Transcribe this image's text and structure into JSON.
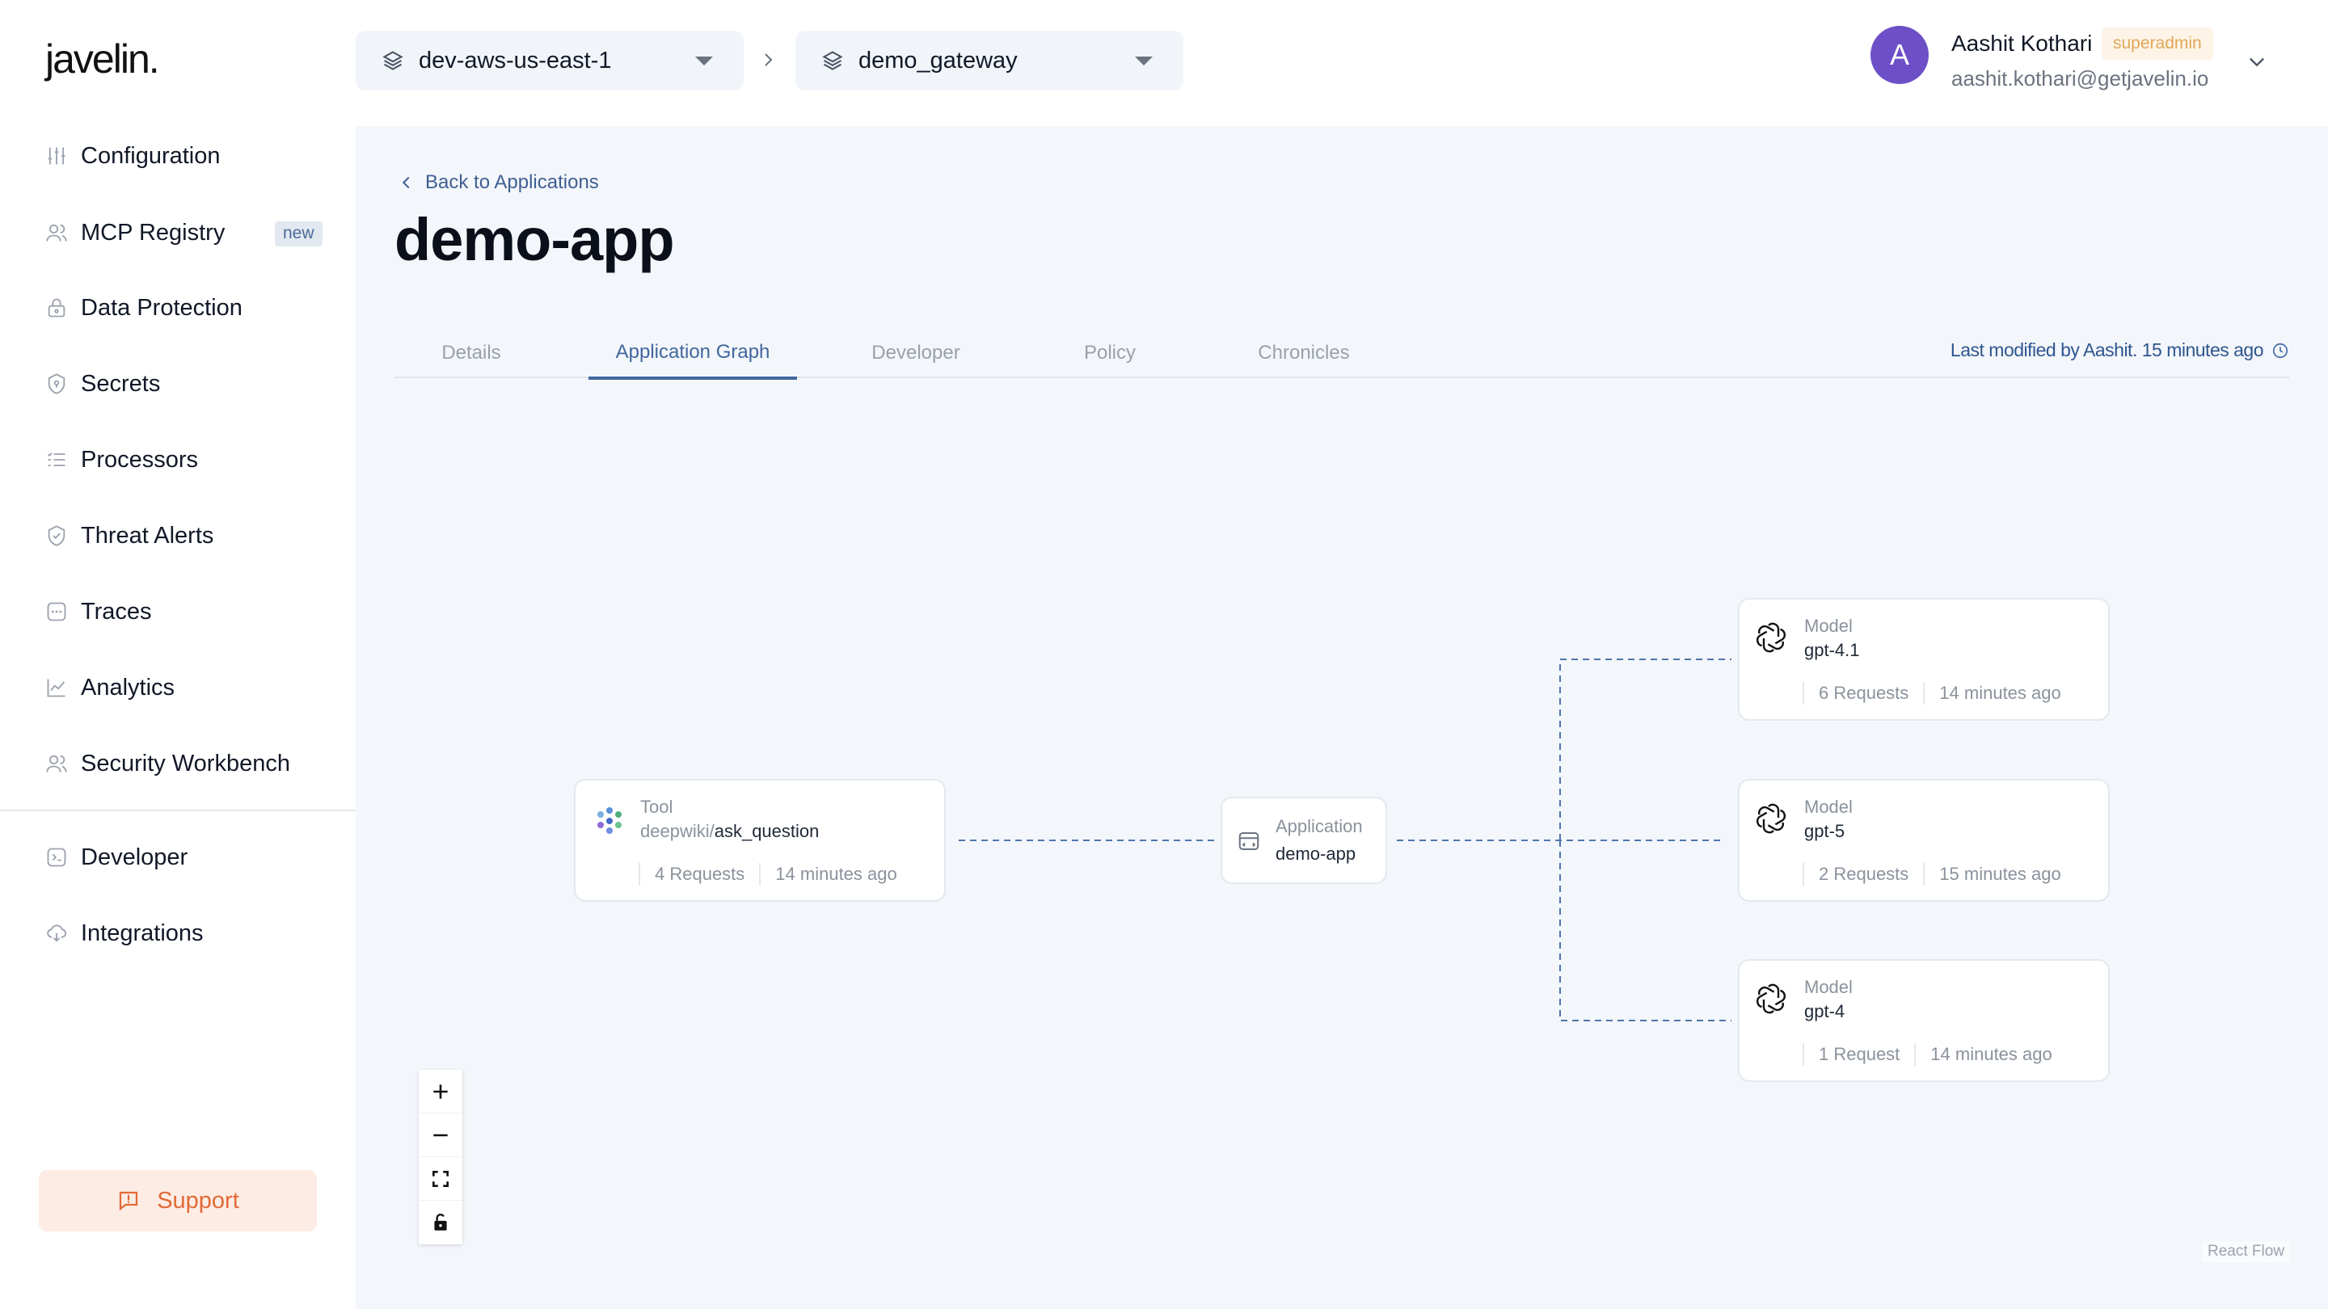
{
  "brand": {
    "logo_text": "javelin."
  },
  "sidebar": {
    "items": [
      {
        "label": "Configuration",
        "icon": "sliders-icon"
      },
      {
        "label": "MCP Registry",
        "icon": "users-icon",
        "badge": "new"
      },
      {
        "label": "Data Protection",
        "icon": "lock-icon"
      },
      {
        "label": "Secrets",
        "icon": "shield-icon"
      },
      {
        "label": "Processors",
        "icon": "list-icon"
      },
      {
        "label": "Threat Alerts",
        "icon": "shield-check-icon"
      },
      {
        "label": "Traces",
        "icon": "traces-icon"
      },
      {
        "label": "Analytics",
        "icon": "chart-line-icon"
      },
      {
        "label": "Security Workbench",
        "icon": "users-icon"
      }
    ],
    "secondary_items": [
      {
        "label": "Developer",
        "icon": "terminal-icon"
      },
      {
        "label": "Integrations",
        "icon": "cloud-icon"
      }
    ],
    "support_label": "Support"
  },
  "header": {
    "environment": "dev-aws-us-east-1",
    "gateway": "demo_gateway",
    "user": {
      "initial": "A",
      "name": "Aashit Kothari",
      "role": "superadmin",
      "email": "aashit.kothari@getjavelin.io",
      "avatar_color": "#6d4fc7"
    }
  },
  "page": {
    "back_label": "Back to Applications",
    "title": "demo-app",
    "tabs": [
      "Details",
      "Application Graph",
      "Developer",
      "Policy",
      "Chronicles"
    ],
    "active_tab": "Application Graph",
    "last_modified": "Last modified by Aashit. 15 minutes ago"
  },
  "graph": {
    "tool": {
      "type": "Tool",
      "prefix": "deepwiki/",
      "name": "ask_question",
      "requests": "4 Requests",
      "time": "14 minutes ago"
    },
    "application": {
      "type": "Application",
      "name": "demo-app"
    },
    "models": [
      {
        "type": "Model",
        "name": "gpt-4.1",
        "requests": "6 Requests",
        "time": "14 minutes ago"
      },
      {
        "type": "Model",
        "name": "gpt-5",
        "requests": "2 Requests",
        "time": "15 minutes ago"
      },
      {
        "type": "Model",
        "name": "gpt-4",
        "requests": "1 Request",
        "time": "14 minutes ago"
      }
    ],
    "attribution": "React Flow"
  },
  "colors": {
    "accent": "#41679d",
    "support": "#e26a37",
    "edge": "#4f75ad"
  }
}
